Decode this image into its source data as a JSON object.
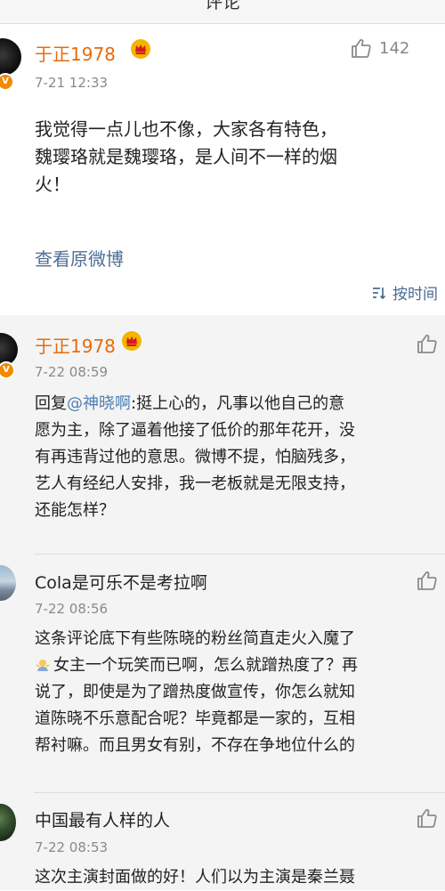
{
  "header": {
    "title": "评论"
  },
  "main_comment": {
    "user": "于正1978",
    "time": "7-21 12:33",
    "like_count": "142",
    "text_lines": [
      "我觉得一点儿也不像，大家各有特色，",
      "魏璎珞就是魏璎珞，是人间不一样的烟",
      "火！"
    ],
    "view_original": "查看原微博",
    "sort_label": "按时间"
  },
  "replies": [
    {
      "user": "于正1978",
      "time": "7-22 08:59",
      "reply_prefix": "回复",
      "mention": "@神晓啊",
      "text_lines": [
        ":挺上心的，凡事以他自己的意",
        "愿为主，除了逼着他接了低价的那年花开，没",
        "有再违背过他的意思。微博不提，怕脑残多，",
        "艺人有经纪人安排，我一老板就是无限支持，",
        "还能怎样？"
      ]
    },
    {
      "user": "Cola是可乐不是考拉啊",
      "time": "7-22 08:56",
      "text_lines": [
        "这条评论底下有些陈晓的粉丝简直走火入魔了",
        "女主一个玩笑而已啊，怎么就蹭热度了？再",
        "说了，即使是为了蹭热度做宣传，你怎么就知",
        "道陈晓不乐意配合呢？毕竟都是一家的，互相",
        "帮衬嘛。而且男女有别，不存在争地位什么的"
      ]
    },
    {
      "user": "中国最有人样的人",
      "time": "7-22 08:53",
      "text_lines": [
        "这次主演封面做的好！人们以为主演是秦兰聂"
      ]
    }
  ],
  "icons": {
    "like": "thumb-up-icon",
    "vip": "crown-icon",
    "verify": "v-badge-icon",
    "sort": "sort-icon",
    "emoji": "shrug-emoji-icon"
  },
  "colors": {
    "username_vip": "#e86b0c",
    "link": "#4f6d94",
    "mention": "#4f7fb3",
    "time": "#8a8a8a",
    "reply_bg": "#f4f4f4"
  }
}
